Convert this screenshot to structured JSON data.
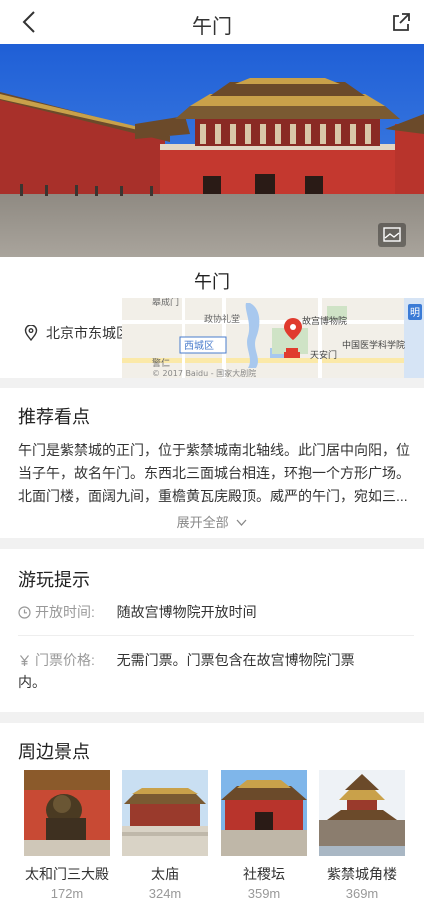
{
  "header": {
    "title": "午门",
    "back_icon": "back-arrow-icon",
    "share_icon": "share-icon"
  },
  "hero": {
    "gallery_icon": "gallery-icon"
  },
  "info": {
    "name": "午门",
    "address": "北京市东城区故宫内",
    "map": {
      "labels": [
        "皋成门",
        "政协礼堂",
        "故宫博物院",
        "西城区",
        "中国医学科学院",
        "天安门",
        "警仁",
        "明",
        "© 2017 Baidu - 国家大剧院"
      ]
    }
  },
  "recommend": {
    "title": "推荐看点",
    "description": "午门是紫禁城的正门，位于紫禁城南北轴线。此门居中向阳，位当子午，故名午门。东西北三面城台相连，环抱一个方形广场。北面门楼，面阔九间，重檐黄瓦庑殿顶。威严的午门，宛如三...",
    "expand_label": "展开全部"
  },
  "tips": {
    "title": "游玩提示",
    "open_label": "开放时间:",
    "open_value": "随故宫博物院开放时间",
    "ticket_label": "门票价格:",
    "ticket_value": "无需门票。门票包含在故宫博物院门票内。"
  },
  "nearby": {
    "title": "周边景点",
    "items": [
      {
        "name": "太和门三大殿",
        "distance": "172m"
      },
      {
        "name": "太庙",
        "distance": "324m"
      },
      {
        "name": "社稷坛",
        "distance": "359m"
      },
      {
        "name": "紫禁城角楼",
        "distance": "369m"
      }
    ]
  },
  "colors": {
    "accent_red": "#e03b2e",
    "wall_red": "#b8342c",
    "sky_blue": "#2f6cd8"
  }
}
